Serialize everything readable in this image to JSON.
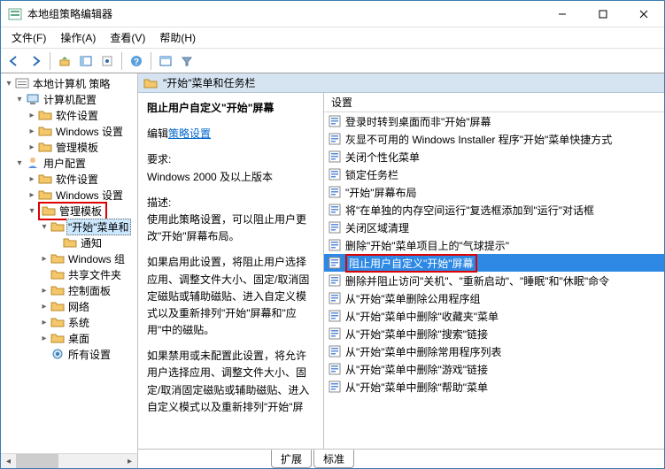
{
  "window": {
    "title": "本地组策略编辑器"
  },
  "menu": {
    "file": "文件(F)",
    "action": "操作(A)",
    "view": "查看(V)",
    "help": "帮助(H)"
  },
  "tree": {
    "root": "本地计算机 策略",
    "computer": {
      "label": "计算机配置",
      "software": "软件设置",
      "windows": "Windows 设置",
      "templates": "管理模板"
    },
    "user": {
      "label": "用户配置",
      "software": "软件设置",
      "windows": "Windows 设置",
      "templates": "管理模板",
      "start": "\"开始\"菜单和",
      "notify": "通知",
      "components": "Windows 组",
      "shared": "共享文件夹",
      "control": "控制面板",
      "network": "网络",
      "system": "系统",
      "desktop": "桌面",
      "allsettings": "所有设置"
    }
  },
  "header": {
    "title": "\"开始\"菜单和任务栏"
  },
  "desc": {
    "title": "阻止用户自定义\"开始\"屏幕",
    "edit_label": "编辑",
    "policy_link": "策略设置",
    "req_label": "要求:",
    "req_value": "Windows 2000 及以上版本",
    "desc_label": "描述:",
    "p1": "使用此策略设置，可以阻止用户更改\"开始\"屏幕布局。",
    "p2": "如果启用此设置，将阻止用户选择应用、调整文件大小、固定/取消固定磁贴或辅助磁贴、进入自定义模式以及重新排列\"开始\"屏幕和\"应用\"中的磁贴。",
    "p3": "如果禁用或未配置此设置，将允许用户选择应用、调整文件大小、固定/取消固定磁贴或辅助磁贴、进入自定义模式以及重新排列\"开始\"屏"
  },
  "list": {
    "header": "设置",
    "items": [
      "登录时转到桌面而非\"开始\"屏幕",
      "灰显不可用的 Windows Installer 程序\"开始\"菜单快捷方式",
      "关闭个性化菜单",
      "锁定任务栏",
      "\"开始\"屏幕布局",
      "将\"在单独的内存空间运行\"复选框添加到\"运行\"对话框",
      "关闭区域清理",
      "删除\"开始\"菜单项目上的\"气球提示\"",
      "阻止用户自定义\"开始\"屏幕",
      "删除并阻止访问\"关机\"、\"重新启动\"、\"睡眠\"和\"休眠\"命令",
      "从\"开始\"菜单删除公用程序组",
      "从\"开始\"菜单中删除\"收藏夹\"菜单",
      "从\"开始\"菜单中删除\"搜索\"链接",
      "从\"开始\"菜单中删除常用程序列表",
      "从\"开始\"菜单中删除\"游戏\"链接",
      "从\"开始\"菜单中删除\"帮助\"菜单"
    ],
    "selected_index": 8
  },
  "tabs": {
    "extended": "扩展",
    "standard": "标准"
  }
}
